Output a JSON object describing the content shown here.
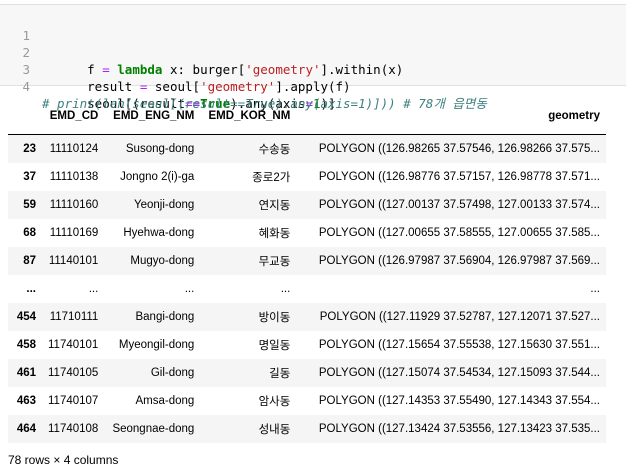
{
  "code": {
    "line_numbers": [
      "1",
      "2",
      "3",
      "4"
    ],
    "line1": {
      "a": "f ",
      "b": "=",
      "c": " ",
      "d": "lambda",
      "e": " x: burger[",
      "f": "'geometry'",
      "g": "].within(x)"
    },
    "line2": {
      "a": "result ",
      "b": "=",
      "c": " seoul[",
      "d": "'geometry'",
      "e": "].apply(f)"
    },
    "line3": {
      "a": "seoul[(result",
      "b": "==",
      "c": "True",
      "d": ").any(axis",
      "e": "=",
      "f": "1",
      "g": ")]"
    },
    "line4": "# print(len(seoul[(result==True).any(axis=1)])) # 78개 읍면동"
  },
  "table": {
    "headers": [
      "",
      "EMD_CD",
      "EMD_ENG_NM",
      "EMD_KOR_NM",
      "geometry"
    ],
    "rows": [
      {
        "idx": "23",
        "cd": "11110124",
        "eng": "Susong-dong",
        "kor": "수송동",
        "geom": "POLYGON ((126.98265 37.57546, 126.98266 37.575..."
      },
      {
        "idx": "37",
        "cd": "11110138",
        "eng": "Jongno 2(i)-ga",
        "kor": "종로2가",
        "geom": "POLYGON ((126.98776 37.57157, 126.98778 37.571..."
      },
      {
        "idx": "59",
        "cd": "11110160",
        "eng": "Yeonji-dong",
        "kor": "연지동",
        "geom": "POLYGON ((127.00137 37.57498, 127.00133 37.574..."
      },
      {
        "idx": "68",
        "cd": "11110169",
        "eng": "Hyehwa-dong",
        "kor": "혜화동",
        "geom": "POLYGON ((127.00655 37.58555, 127.00655 37.585..."
      },
      {
        "idx": "87",
        "cd": "11140101",
        "eng": "Mugyo-dong",
        "kor": "무교동",
        "geom": "POLYGON ((126.97987 37.56904, 126.97987 37.569..."
      },
      {
        "idx": "...",
        "cd": "...",
        "eng": "...",
        "kor": "...",
        "geom": "..."
      },
      {
        "idx": "454",
        "cd": "11710111",
        "eng": "Bangi-dong",
        "kor": "방이동",
        "geom": "POLYGON ((127.11929 37.52787, 127.12071 37.527..."
      },
      {
        "idx": "458",
        "cd": "11740101",
        "eng": "Myeongil-dong",
        "kor": "명일동",
        "geom": "POLYGON ((127.15654 37.55538, 127.15630 37.551..."
      },
      {
        "idx": "461",
        "cd": "11740105",
        "eng": "Gil-dong",
        "kor": "길동",
        "geom": "POLYGON ((127.15074 37.54534, 127.15093 37.544..."
      },
      {
        "idx": "463",
        "cd": "11740107",
        "eng": "Amsa-dong",
        "kor": "암사동",
        "geom": "POLYGON ((127.14353 37.55490, 127.14343 37.554..."
      },
      {
        "idx": "464",
        "cd": "11740108",
        "eng": "Seongnae-dong",
        "kor": "성내동",
        "geom": "POLYGON ((127.13424 37.53556, 127.13423 37.535..."
      }
    ]
  },
  "footer": "78 rows × 4 columns"
}
